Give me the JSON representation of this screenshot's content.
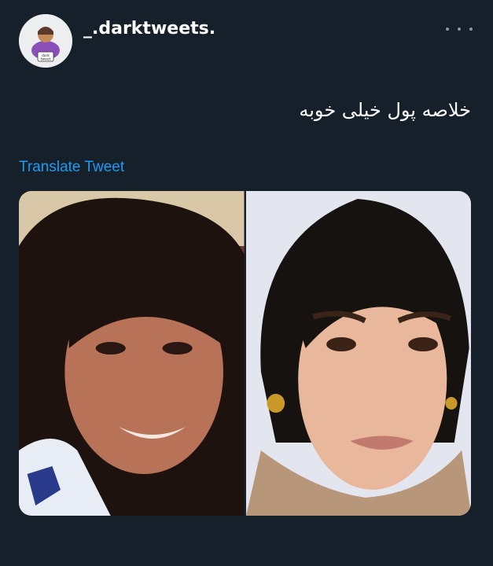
{
  "tweet": {
    "username": "_.darktweets.",
    "avatar_text": "dark tweet",
    "text": "خلاصه پول خیلی خوبه",
    "translate_label": "Translate Tweet",
    "more_icon": "more-horizontal-icon"
  },
  "media": {
    "photos": [
      {
        "description_name": "before-photo"
      },
      {
        "description_name": "after-photo"
      }
    ]
  },
  "colors": {
    "background": "#15202b",
    "link": "#1d9bf0",
    "muted": "#8899a6"
  }
}
